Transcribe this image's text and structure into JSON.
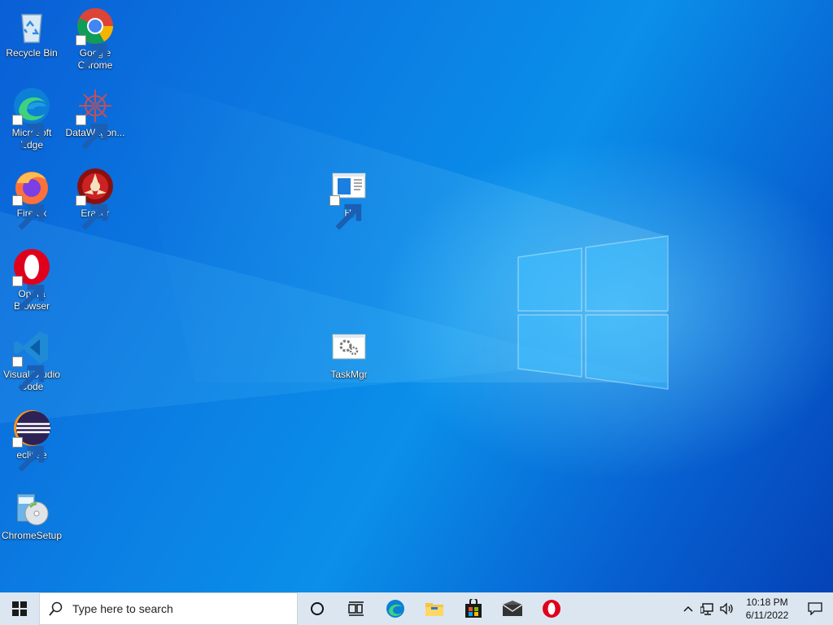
{
  "desktop": {
    "icons": [
      {
        "label": "Recycle Bin",
        "icon": "recycle-bin-icon"
      },
      {
        "label": "Google Chrome",
        "icon": "chrome-icon"
      },
      {
        "label": "Microsoft Edge",
        "icon": "edge-icon"
      },
      {
        "label": "DataWagon...",
        "icon": "datawagon-icon"
      },
      {
        "label": "Firefox",
        "icon": "firefox-icon"
      },
      {
        "label": "Eraser",
        "icon": "eraser-icon"
      },
      {
        "label": "Hi",
        "icon": "window-app-icon"
      },
      {
        "label": "Opera Browser",
        "icon": "opera-icon"
      },
      {
        "label": "Visual Studio Code",
        "icon": "vscode-icon"
      },
      {
        "label": "TaskMgr",
        "icon": "taskmgr-icon"
      },
      {
        "label": "eclipse",
        "icon": "eclipse-icon"
      },
      {
        "label": "ChromeSetup",
        "icon": "installer-icon"
      }
    ]
  },
  "taskbar": {
    "search_placeholder": "Type here to search",
    "pinned": [
      "cortana-icon",
      "task-view-icon",
      "edge-icon",
      "file-explorer-icon",
      "store-icon",
      "mail-icon",
      "opera-icon"
    ],
    "clock": {
      "time": "10:18 PM",
      "date": "6/11/2022"
    }
  },
  "colors": {
    "accent": "#0a7fe3",
    "taskbar": "#dbe6f0"
  }
}
